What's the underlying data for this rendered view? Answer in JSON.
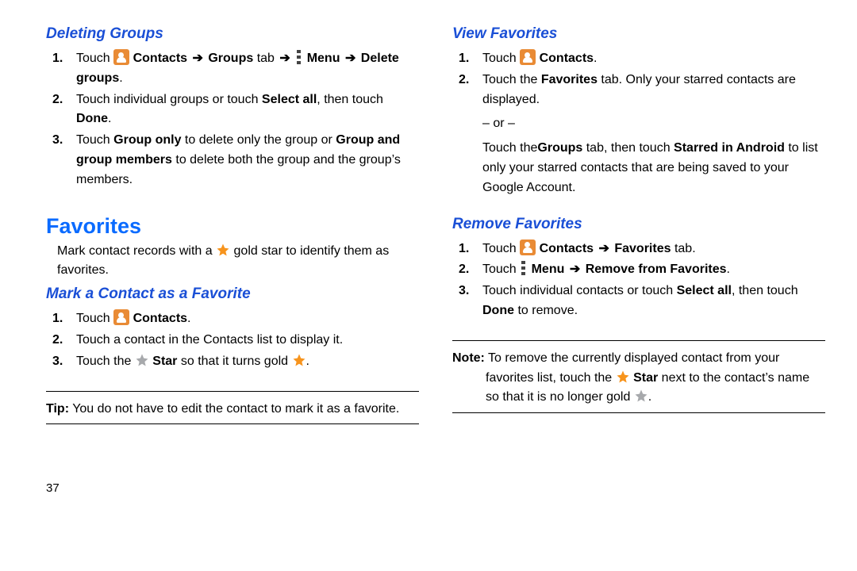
{
  "left": {
    "h_deleting": "Deleting Groups",
    "del1_a": "Touch ",
    "del1_b": " Contacts",
    "del1_c": " Groups",
    "del1_d": " tab ",
    "del1_e": " Menu",
    "del1_f": "Delete groups",
    "del2_a": "Touch individual groups or touch ",
    "del2_b": "Select all",
    "del2_c": ", then touch ",
    "del2_d": "Done",
    "del3_a": "Touch ",
    "del3_b": "Group only",
    "del3_c": " to delete only the group or ",
    "del3_d": "Group and group members",
    "del3_e": " to delete both the group and the group’s members.",
    "h_favorites": "Favorites",
    "fav_intro_a": "Mark contact records with a ",
    "fav_intro_b": " gold star to identify them as favorites.",
    "h_mark": "Mark a Contact as a Favorite",
    "mark1_a": "Touch ",
    "mark1_b": " Contacts",
    "mark2": "Touch a contact in the Contacts list to display it.",
    "mark3_a": "Touch the ",
    "mark3_b": " Star",
    "mark3_c": " so that it turns gold ",
    "tip_lead": "Tip:",
    "tip_body": " You do not have to edit the contact to mark it as a favorite.",
    "pagenum": "37"
  },
  "right": {
    "h_view": "View Favorites",
    "view1_a": "Touch ",
    "view1_b": " Contacts",
    "view2_a": "Touch the ",
    "view2_b": "Favorites",
    "view2_c": " tab. Only your starred contacts are displayed.",
    "view_or": "– or –",
    "view_alt_a": "Touch the",
    "view_alt_b": "Groups ",
    "view_alt_c": " tab, then touch ",
    "view_alt_d": "Starred in Android",
    "view_alt_e": " to list only your starred contacts that are being saved to your Google Account.",
    "h_remove": "Remove Favorites",
    "rem1_a": "Touch ",
    "rem1_b": " Contacts",
    "rem1_c": " Favorites",
    "rem1_d": " tab.",
    "rem2_a": "Touch ",
    "rem2_b": " Menu",
    "rem2_c": " Remove from Favorites",
    "rem3_a": "Touch individual contacts or touch ",
    "rem3_b": "Select all",
    "rem3_c": ", then touch ",
    "rem3_d": "Done",
    "rem3_e": " to remove.",
    "note_lead": "Note:",
    "note_a": " To remove the currently displayed contact from your favorites list, touch the ",
    "note_b": " Star",
    "note_c": " next to the contact’s name so that it is no longer gold ",
    "arrow": "➔",
    "period": "."
  }
}
